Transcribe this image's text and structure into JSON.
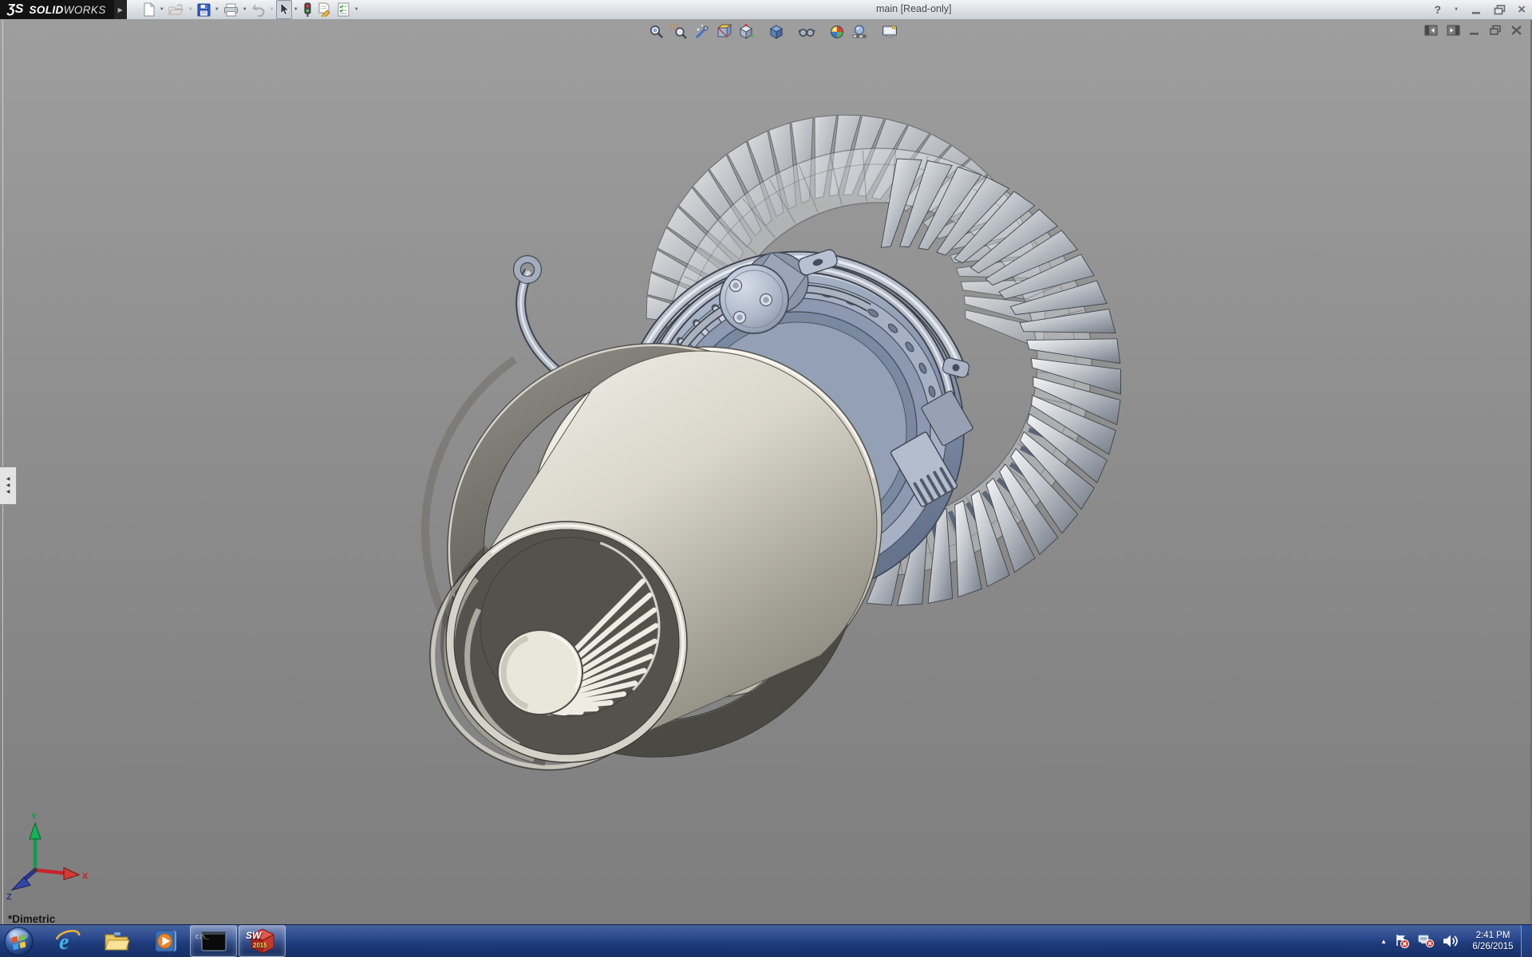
{
  "window": {
    "brand_mark": "ƷS",
    "brand_solid": "SOLID",
    "brand_works": "WORKS",
    "title": "main [Read-only]",
    "help_glyph": "?",
    "close_glyph": "×"
  },
  "main_toolbar": {
    "items": [
      "new-document",
      "open-document",
      "save",
      "print",
      "undo",
      "select",
      "rebuild-traffic-light",
      "file-properties",
      "options"
    ]
  },
  "hud_toolbar": {
    "items": [
      "zoom-to-fit",
      "zoom-to-area",
      "previous-view",
      "section-view",
      "view-orientation",
      "display-style",
      "hide-show-items",
      "edit-appearance",
      "apply-scene",
      "view-settings"
    ]
  },
  "document_controls": {
    "items": [
      "show-feature-pane",
      "show-display-pane",
      "minimize-document",
      "restore-document",
      "close-document"
    ]
  },
  "viewport": {
    "view_label": "*Dimetric",
    "triad": {
      "x_label": "X",
      "y_label": "Y",
      "z_label": "Z"
    }
  },
  "left_panel": {
    "collapsed": true
  },
  "taskbar": {
    "buttons": [
      "start",
      "internet-explorer",
      "windows-explorer",
      "media-player",
      "command-prompt",
      "solidworks-2015"
    ],
    "ie_glyph": "e",
    "command_prompt_text": "C:\\_",
    "solidworks_badge": "SW",
    "solidworks_year": "2015",
    "tray": {
      "icons": [
        "hidden-icons-chevron",
        "action-center-flag",
        "network-error",
        "volume"
      ],
      "time": "2:41 PM",
      "date": "6/26/2015"
    }
  },
  "icons": {
    "caret_down": "▼",
    "flyout_right": "▶",
    "chevron_up": "▲"
  },
  "colors": {
    "taskbar_blue": "#24407e",
    "titlebar_gray": "#dcdfe3",
    "viewport_top": "#9e9e9e",
    "viewport_bottom": "#7e7e7e",
    "logo_black": "#121212",
    "solidworks_red": "#c8392f"
  }
}
